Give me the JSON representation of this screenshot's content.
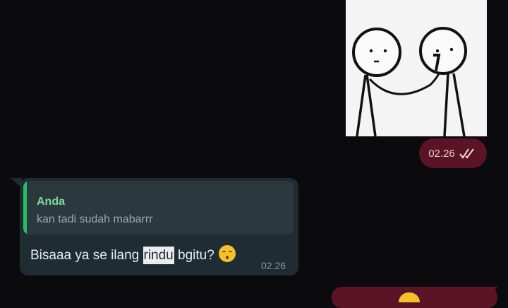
{
  "image_message": {
    "sticker_description_icon": "stick-figures-sticker",
    "time": "02.26",
    "status_icon": "double-check-icon"
  },
  "incoming_message": {
    "reply": {
      "author": "Anda",
      "text": "kan tadi sudah mabarrr"
    },
    "text_before": "Bisaaa ya se ilang ",
    "text_highlight": "rindu",
    "text_after": " bgitu?",
    "emoji_icon": "hushed-face-emoji",
    "time": "02.26"
  },
  "colors": {
    "background": "#0b0b0d",
    "outgoing_bubble": "#5b1426",
    "incoming_bubble": "#1f2c33",
    "quote_bar": "#21c063",
    "quote_author": "#7ed6a0"
  }
}
